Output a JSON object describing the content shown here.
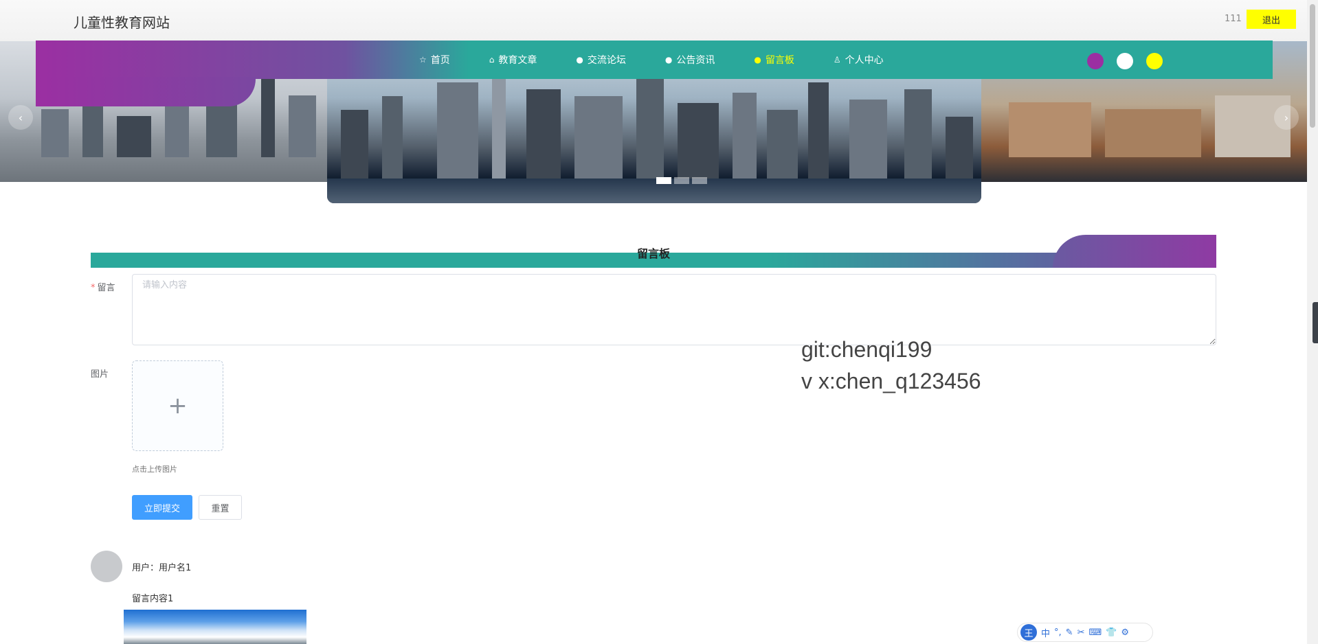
{
  "header": {
    "site_title": "儿童性教育网站",
    "username": "111",
    "logout_label": "退出"
  },
  "nav": {
    "items": [
      {
        "label": "首页",
        "icon": "star-icon",
        "glyph": "☆",
        "active": false
      },
      {
        "label": "教育文章",
        "icon": "shopping-bag-icon",
        "glyph": "⌂",
        "active": false
      },
      {
        "label": "交流论坛",
        "icon": "info-circle-icon",
        "glyph": "●",
        "active": false
      },
      {
        "label": "公告资讯",
        "icon": "info-circle-icon",
        "glyph": "●",
        "active": false
      },
      {
        "label": "留言板",
        "icon": "info-circle-icon",
        "glyph": "●",
        "active": true
      },
      {
        "label": "个人中心",
        "icon": "user-icon",
        "glyph": "♙",
        "active": false
      }
    ],
    "theme_colors": [
      "#9b2fa2",
      "#ffffff",
      "#ffff00"
    ]
  },
  "banner": {
    "prev_glyph": "‹",
    "next_glyph": "›",
    "indicator_count": 3,
    "active_indicator": 0
  },
  "section": {
    "title": "留言板"
  },
  "form": {
    "message_label": "留言",
    "required_mark": "*",
    "message_placeholder": "请输入内容",
    "message_value": "",
    "image_label": "图片",
    "upload_glyph": "+",
    "upload_tip": "点击上传图片",
    "submit_label": "立即提交",
    "reset_label": "重置"
  },
  "watermark": {
    "line1": "git:chenqi199",
    "line2": "v x:chen_q123456"
  },
  "comments": [
    {
      "user_prefix": "用户：",
      "user_name": "用户名1",
      "content": "留言内容1"
    }
  ],
  "ime_toolbar": {
    "logo": "王",
    "items": [
      "中",
      "°,",
      "✎",
      "✂",
      "⌨",
      "👕",
      "⚙"
    ]
  },
  "colors": {
    "teal": "#2aa89b",
    "purple": "#9b2fa2",
    "highlight_yellow": "#ffff00",
    "primary_blue": "#409eff"
  }
}
